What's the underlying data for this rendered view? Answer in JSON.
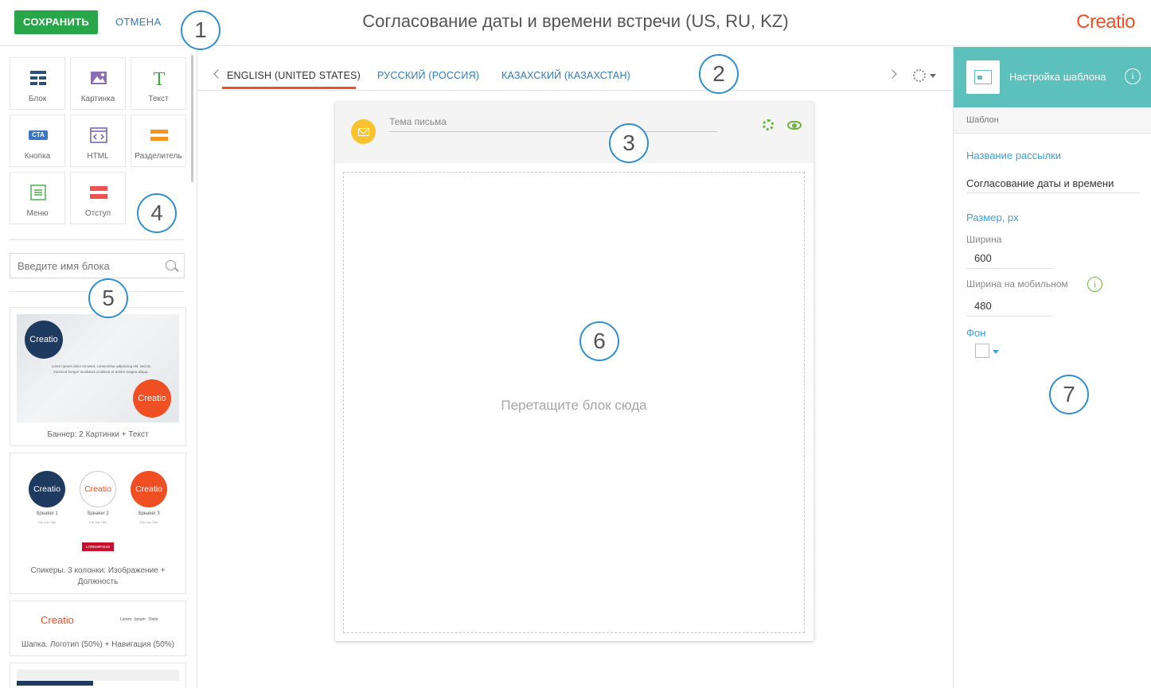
{
  "header": {
    "save_label": "СОХРАНИТЬ",
    "cancel_label": "ОТМЕНА",
    "title": "Согласование даты и времени встречи (US, RU, KZ)",
    "logo_text": "Creatio"
  },
  "callouts": [
    "1",
    "2",
    "3",
    "4",
    "5",
    "6",
    "7"
  ],
  "blocks": {
    "tiles": [
      {
        "label": "Блок",
        "icon": "layout-grid-icon"
      },
      {
        "label": "Картинка",
        "icon": "image-icon"
      },
      {
        "label": "Текст",
        "icon": "text-icon"
      },
      {
        "label": "Кнопка",
        "icon": "cta-button-icon",
        "icon_text": "CTA"
      },
      {
        "label": "HTML",
        "icon": "html-code-icon"
      },
      {
        "label": "Разделитель",
        "icon": "divider-icon"
      },
      {
        "label": "Меню",
        "icon": "menu-icon"
      },
      {
        "label": "Отступ",
        "icon": "spacer-icon"
      }
    ],
    "search_placeholder": "Введите имя блока"
  },
  "templates": [
    {
      "caption": "Баннер: 2 Картинки + Текст",
      "logo_text": "Creatio",
      "banner_text": "Lorem ipsum dolor sit amet, consectetur adipiscing elit, sed do eiusmod tempor incididunt ut labore et dolore magna aliqua."
    },
    {
      "caption": "Спикеры. 3 колонки: Изображение + Должность",
      "logo_text": "Creatio",
      "speakers": [
        {
          "name": "Speaker 1",
          "title": "Full Job Title"
        },
        {
          "name": "Speaker 2",
          "title": "Full Job Title"
        },
        {
          "name": "Speaker 3",
          "title": "Full Job Title"
        }
      ],
      "button_text": "LOREMIPSUM"
    },
    {
      "caption": "Шапка. Логотип (50%) + Навигация (50%)",
      "logo_text": "Creatio",
      "nav": [
        "Lorem",
        "Ipsum",
        "Dolor"
      ]
    }
  ],
  "tabs": [
    {
      "label": "ENGLISH (UNITED STATES)",
      "active": true
    },
    {
      "label": "РУССКИЙ (РОССИЯ)",
      "active": false
    },
    {
      "label": "КАЗАХСКИЙ (КАЗАХСТАН)",
      "active": false
    }
  ],
  "email": {
    "subject_placeholder": "Тема письма",
    "drop_text": "Перетащите блок сюда"
  },
  "settings": {
    "title": "Настройка шаблона",
    "section": "Шаблон",
    "name_label": "Название рассылки",
    "name_value": "Согласование даты и времени",
    "size_label": "Размер, px",
    "width_label": "Ширина",
    "width_value": "600",
    "mobile_width_label": "Ширина на мобильном",
    "mobile_width_value": "480",
    "background_label": "Фон"
  },
  "colors": {
    "accent": "#f04e23",
    "save_button": "#2aa64a",
    "link": "#337ab7",
    "panel_header": "#5cc1bd",
    "callout_border": "#2f8fd1"
  }
}
